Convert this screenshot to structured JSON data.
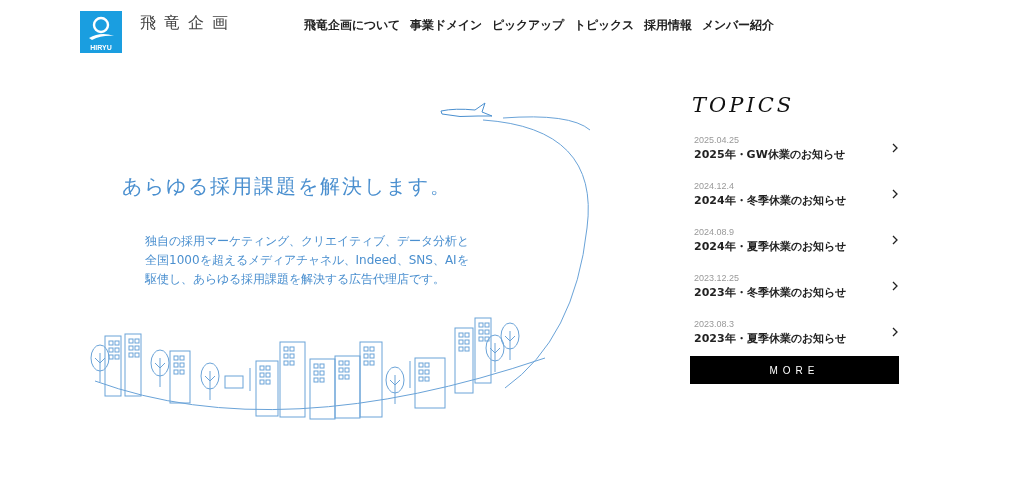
{
  "header": {
    "logo_text": "HIRYU",
    "brand": "飛竜企画",
    "nav": [
      {
        "label": "飛竜企画について"
      },
      {
        "label": "事業ドメイン"
      },
      {
        "label": "ピックアップ"
      },
      {
        "label": "トピックス"
      },
      {
        "label": "採用情報"
      },
      {
        "label": "メンバー紹介"
      }
    ]
  },
  "hero": {
    "title": "あらゆる採用課題を解決します。",
    "lines": [
      "独自の採用マーケティング、クリエイティブ、データ分析と",
      "全国1000を超えるメディアチャネル、Indeed、SNS、AIを",
      "駆使し、あらゆる採用課題を解決する広告代理店です。"
    ]
  },
  "topics": {
    "heading": "TOPICS",
    "items": [
      {
        "date": "2025.04.25",
        "title": "2025年・GW休業のお知らせ"
      },
      {
        "date": "2024.12.4",
        "title": "2024年・冬季休業のお知らせ"
      },
      {
        "date": "2024.08.9",
        "title": "2024年・夏季休業のお知らせ"
      },
      {
        "date": "2023.12.25",
        "title": "2023年・冬季休業のお知らせ"
      },
      {
        "date": "2023.08.3",
        "title": "2023年・夏季休業のお知らせ"
      }
    ],
    "more": "MORE"
  }
}
